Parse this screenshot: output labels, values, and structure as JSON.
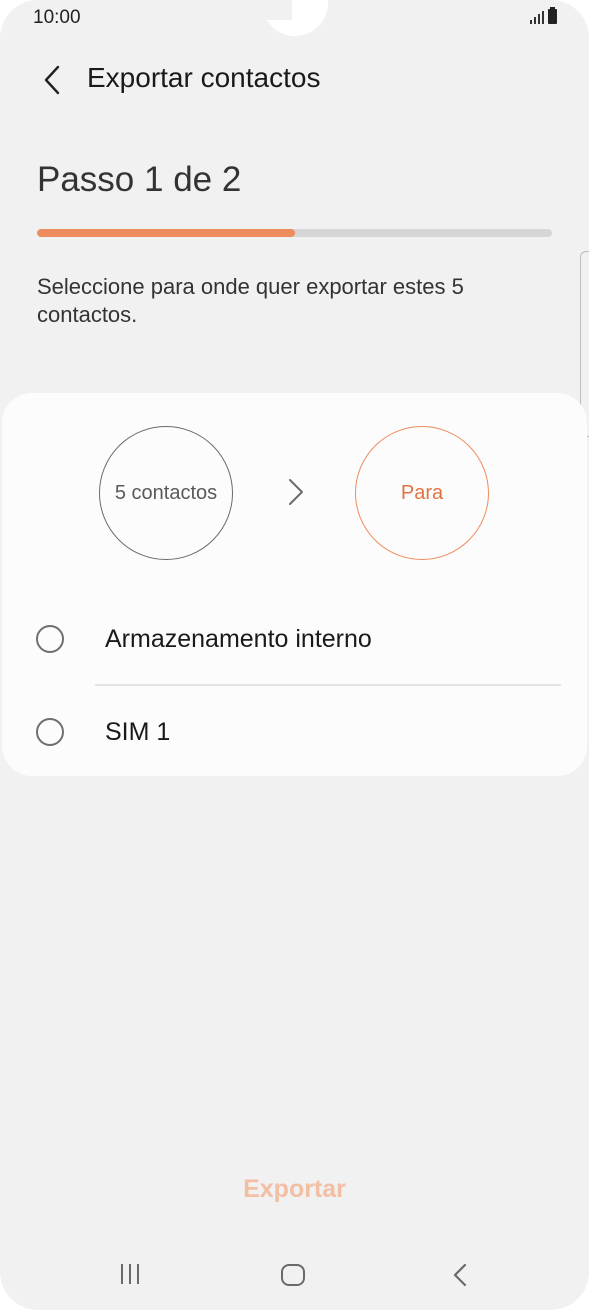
{
  "status_bar": {
    "time": "10:00"
  },
  "header": {
    "title": "Exportar contactos",
    "back_icon": "chevron-left-icon"
  },
  "step": {
    "title": "Passo 1 de 2",
    "progress": 0.5,
    "progress_color": "#ef8c5e"
  },
  "description": "Seleccione para onde quer exportar estes 5 contactos.",
  "flow": {
    "from_label": "5 contactos",
    "to_label": "Para",
    "arrow_icon": "chevron-right-icon"
  },
  "options": [
    {
      "label": "Armazenamento interno",
      "selected": false
    },
    {
      "label": "SIM 1",
      "selected": false
    }
  ],
  "footer": {
    "export_label": "Exportar",
    "export_color": "#f2bfa4"
  },
  "navbar": {
    "recents_icon": "recents-icon",
    "home_icon": "home-icon",
    "back_icon": "back-icon"
  }
}
